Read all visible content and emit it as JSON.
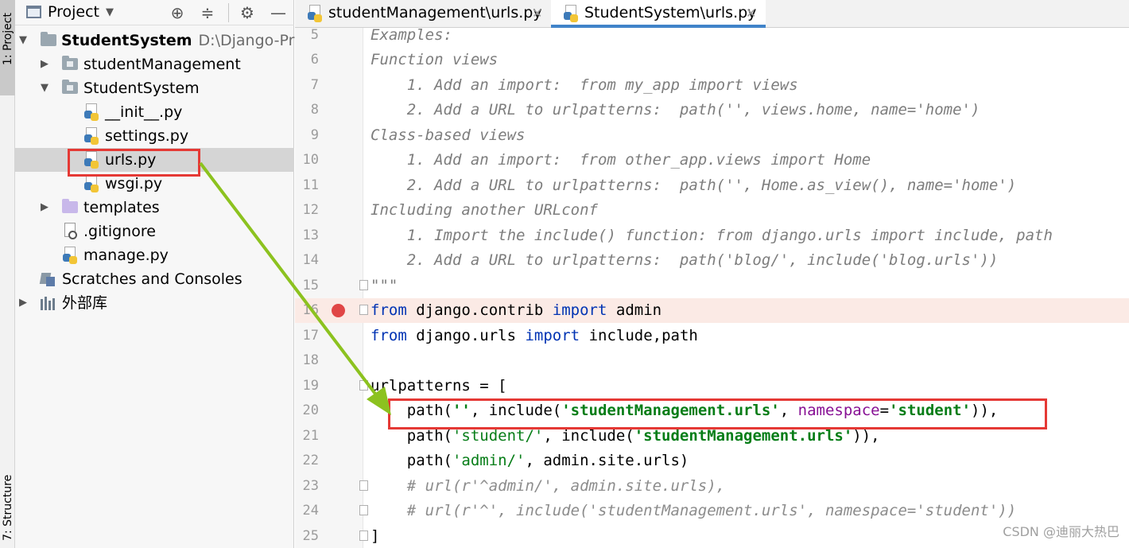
{
  "tool_strip": {
    "project_tab": "1: Project",
    "structure_tab": "7: Structure"
  },
  "project_panel": {
    "title": "Project",
    "tree": {
      "root": {
        "name": "StudentSystem",
        "path": "D:\\Django-Projec"
      },
      "studentManagement": "studentManagement",
      "StudentSystem": "StudentSystem",
      "init": "__init__.py",
      "settings": "settings.py",
      "urls": "urls.py",
      "wsgi": "wsgi.py",
      "templates": "templates",
      "gitignore": ".gitignore",
      "manage": "manage.py",
      "scratches": "Scratches and Consoles",
      "external": "外部库"
    }
  },
  "tabs": [
    {
      "label": "studentManagement\\urls.py",
      "active": false
    },
    {
      "label": "StudentSystem\\urls.py",
      "active": true
    }
  ],
  "editor": {
    "lines": {
      "l5": {
        "num": "5",
        "text": "Examples:"
      },
      "l6": {
        "num": "6",
        "text": "Function views"
      },
      "l7": {
        "num": "7",
        "text": "    1. Add an import:  from my_app import views"
      },
      "l8": {
        "num": "8",
        "text": "    2. Add a URL to urlpatterns:  path('', views.home, name='home')"
      },
      "l9": {
        "num": "9",
        "text": "Class-based views"
      },
      "l10": {
        "num": "10",
        "text": "    1. Add an import:  from other_app.views import Home"
      },
      "l11": {
        "num": "11",
        "text": "    2. Add a URL to urlpatterns:  path('', Home.as_view(), name='home')"
      },
      "l12": {
        "num": "12",
        "text": "Including another URLconf"
      },
      "l13": {
        "num": "13",
        "text": "    1. Import the include() function: from django.urls import include, path"
      },
      "l14": {
        "num": "14",
        "text": "    2. Add a URL to urlpatterns:  path('blog/', include('blog.urls'))"
      },
      "l15": {
        "num": "15",
        "text": "\"\"\""
      },
      "l16": {
        "num": "16",
        "kw1": "from",
        "mid": " django.contrib ",
        "kw2": "import",
        "tail": " admin"
      },
      "l17": {
        "num": "17",
        "kw1": "from",
        "mid": " django.urls ",
        "kw2": "import",
        "tail": " include,path"
      },
      "l18": {
        "num": "18"
      },
      "l19": {
        "num": "19",
        "text": "urlpatterns = ["
      },
      "l20": {
        "num": "20",
        "a": "    path(",
        "b": "''",
        "c": ", include(",
        "d": "'studentManagement.urls'",
        "e": ", ",
        "f": "namespace",
        "g": "=",
        "h": "'student'",
        "i": ")),"
      },
      "l21": {
        "num": "21",
        "a": "    path(",
        "b": "'student/'",
        "c": ", include(",
        "d": "'studentManagement.urls'",
        "e": ")),"
      },
      "l22": {
        "num": "22",
        "a": "    path(",
        "b": "'admin/'",
        "c": ", admin.site.urls)"
      },
      "l23": {
        "num": "23",
        "text": "    # url(r'^admin/', admin.site.urls),"
      },
      "l24": {
        "num": "24",
        "text": "    # url(r'^', include('studentManagement.urls', namespace='student'))"
      },
      "l25": {
        "num": "25",
        "text": "]"
      }
    }
  },
  "watermark": "CSDN @迪丽大热巴",
  "colors": {
    "annotation_red": "#e53935",
    "annotation_green": "#8cc21f",
    "keyword": "#0033b3",
    "string": "#067d17",
    "named_arg": "#871094"
  }
}
